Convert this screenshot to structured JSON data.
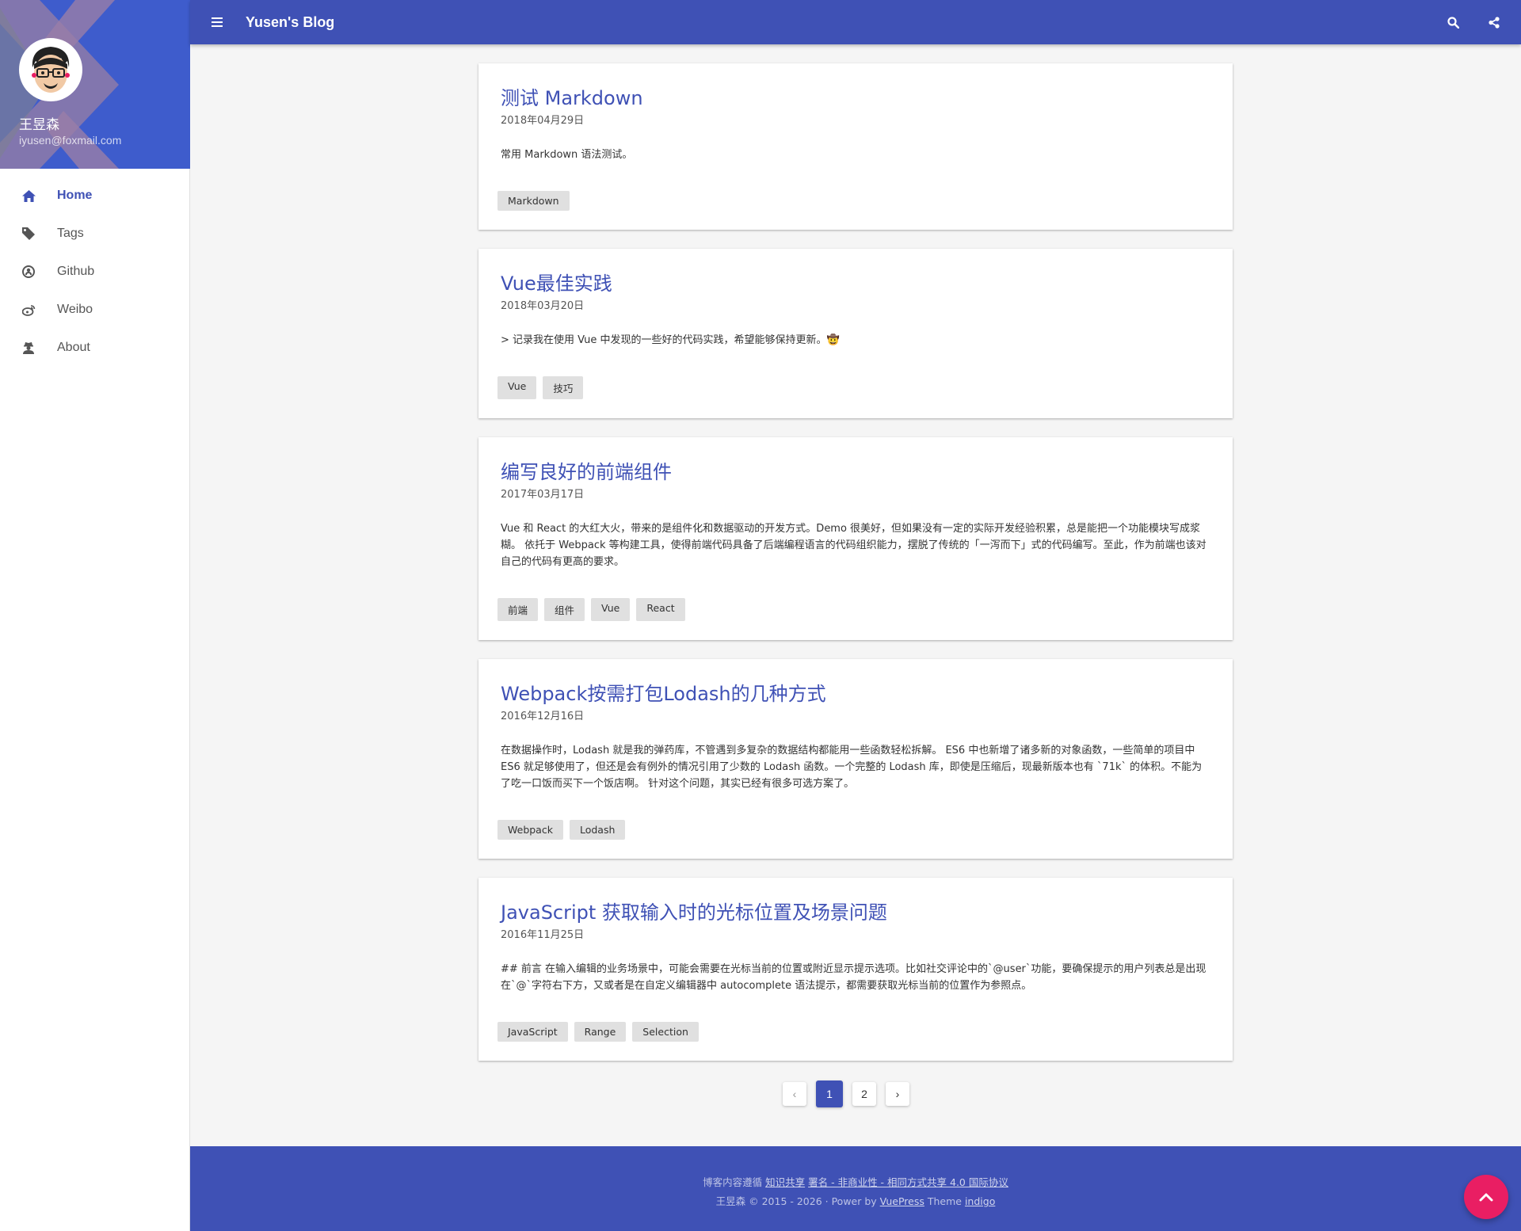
{
  "profile": {
    "name": "王昱森",
    "email": "iyusen@foxmail.com"
  },
  "sidebar": {
    "items": [
      {
        "label": "Home",
        "icon": "home-icon"
      },
      {
        "label": "Tags",
        "icon": "tag-icon"
      },
      {
        "label": "Github",
        "icon": "github-icon"
      },
      {
        "label": "Weibo",
        "icon": "weibo-icon"
      },
      {
        "label": "About",
        "icon": "user-secret-icon"
      }
    ]
  },
  "header": {
    "title": "Yusen's Blog"
  },
  "posts": [
    {
      "title": "测试 Markdown",
      "date": "2018年04月29日",
      "excerpt": "常用 Markdown 语法测试。",
      "tags": [
        "Markdown"
      ]
    },
    {
      "title": "Vue最佳实践",
      "date": "2018年03月20日",
      "excerpt": "> 记录我在使用 Vue 中发现的一些好的代码实践，希望能够保持更新。🤠",
      "tags": [
        "Vue",
        "技巧"
      ]
    },
    {
      "title": "编写良好的前端组件",
      "date": "2017年03月17日",
      "excerpt": "Vue 和 React 的大红大火，带来的是组件化和数据驱动的开发方式。Demo 很美好，但如果没有一定的实际开发经验积累，总是能把一个功能模块写成浆糊。 依托于 Webpack 等构建工具，使得前端代码具备了后端编程语言的代码组织能力，摆脱了传统的「一泻而下」式的代码编写。至此，作为前端也该对自己的代码有更高的要求。",
      "tags": [
        "前端",
        "组件",
        "Vue",
        "React"
      ]
    },
    {
      "title": "Webpack按需打包Lodash的几种方式",
      "date": "2016年12月16日",
      "excerpt": "在数据操作时，Lodash 就是我的弹药库，不管遇到多复杂的数据结构都能用一些函数轻松拆解。 ES6 中也新增了诸多新的对象函数，一些简单的项目中 ES6 就足够使用了，但还是会有例外的情况引用了少数的 Lodash 函数。一个完整的 Lodash 库，即使是压缩后，现最新版本也有 `71k` 的体积。不能为了吃一口饭而买下一个饭店啊。 针对这个问题，其实已经有很多可选方案了。",
      "tags": [
        "Webpack",
        "Lodash"
      ]
    },
    {
      "title": "JavaScript 获取输入时的光标位置及场景问题",
      "date": "2016年11月25日",
      "excerpt": "## 前言 在输入编辑的业务场景中，可能会需要在光标当前的位置或附近显示提示选项。比如社交评论中的`@user`功能，要确保提示的用户列表总是出现在`@`字符右下方，又或者是在自定义编辑器中 autocomplete 语法提示，都需要获取光标当前的位置作为参照点。",
      "tags": [
        "JavaScript",
        "Range",
        "Selection"
      ]
    }
  ],
  "pagination": {
    "prev": "‹",
    "pages": [
      "1",
      "2"
    ],
    "current": "1",
    "next": "›"
  },
  "footer": {
    "line1_prefix": "博客内容遵循 ",
    "line1_link1": "知识共享",
    "line1_link2": "署名 - 非商业性 - 相同方式共享 4.0 国际协议",
    "line2_prefix": "王昱森 © 2015 - 2026 · Power by ",
    "line2_link1": "VuePress",
    "line2_mid": " Theme ",
    "line2_link2": "indigo"
  },
  "colors": {
    "primary": "#3f51b5",
    "accent": "#e91e63",
    "background": "#f5f5f5"
  }
}
